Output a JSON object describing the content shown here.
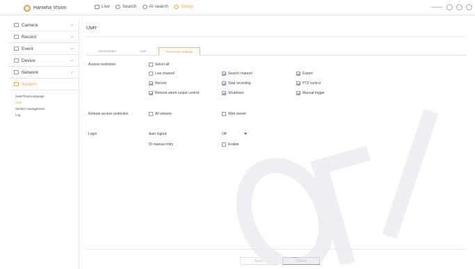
{
  "header": {
    "brand": "Hanwha Vision",
    "nav": [
      {
        "label": "Live"
      },
      {
        "label": "Search"
      },
      {
        "label": "AI search"
      },
      {
        "label": "Setup"
      }
    ],
    "user": "••••••••••"
  },
  "sidebar": {
    "items": [
      {
        "label": "Camera"
      },
      {
        "label": "Record"
      },
      {
        "label": "Event"
      },
      {
        "label": "Device"
      },
      {
        "label": "Network"
      },
      {
        "label": "System"
      }
    ],
    "submenu": [
      {
        "label": "Date/Time/Language"
      },
      {
        "label": "User"
      },
      {
        "label": "System management"
      },
      {
        "label": "Log"
      }
    ]
  },
  "main": {
    "title": "User",
    "tabs": [
      {
        "label": "Administrator"
      },
      {
        "label": "User"
      },
      {
        "label": "Permission settings"
      }
    ],
    "access_restriction": {
      "label": "Access restriction",
      "select_all": "Select all",
      "options": [
        {
          "label": "Live channel",
          "checked": false
        },
        {
          "label": "Search channel",
          "checked": true
        },
        {
          "label": "Export",
          "checked": true
        },
        {
          "label": "Record",
          "checked": true
        },
        {
          "label": "Stop recording",
          "checked": true
        },
        {
          "label": "PTZ control",
          "checked": true
        },
        {
          "label": "Remote alarm output control",
          "checked": true
        },
        {
          "label": "Shutdown",
          "checked": true
        },
        {
          "label": "Manual trigger",
          "checked": true
        }
      ]
    },
    "remote_access": {
      "label": "Remote access restriction",
      "options": [
        {
          "label": "All viewers",
          "checked": false
        },
        {
          "label": "Web viewer",
          "checked": false
        }
      ]
    },
    "login": {
      "label": "Login",
      "auto_logout_label": "Auto logout",
      "auto_logout_value": "Off",
      "id_manual_label": "ID manual entry",
      "id_manual_option": "Enable"
    },
    "buttons": {
      "apply": "Apply",
      "cancel": "Cancel"
    }
  },
  "colors": {
    "accent": "#f0a03c",
    "check": "#3a86c8"
  }
}
